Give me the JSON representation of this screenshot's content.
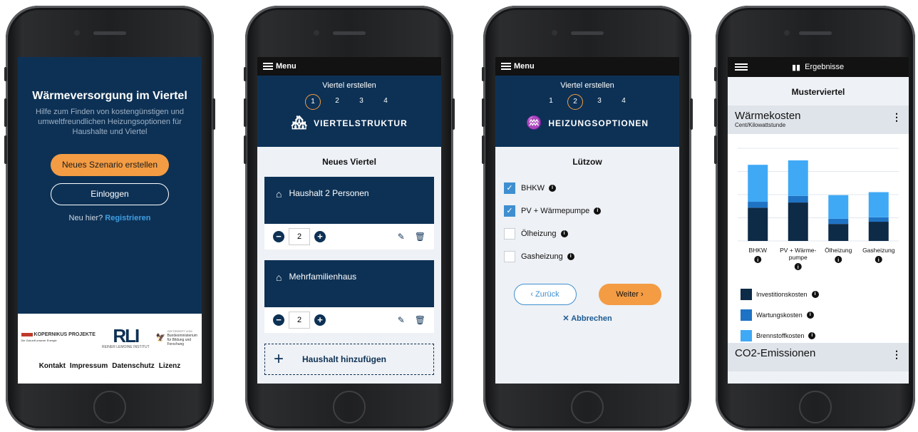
{
  "screen1": {
    "title": "Wärmeversorgung im Viertel",
    "subtitle": "Hilfe zum Finden von kostengünstigen und umweltfreundlichen Heizungsoptionen für Haushalte und Viertel",
    "primary_button": "Neues Szenario erstellen",
    "login_button": "Einloggen",
    "new_here": "Neu hier?",
    "register_link": "Registrieren",
    "logo_kopernikus": "KOPERNIKUS PROJEKTE",
    "logo_kopernikus_sub": "Die Zukunft unserer Energie",
    "logo_rli": "RLI",
    "logo_rli_sub": "REINER LEMOINE INSTITUT",
    "logo_bmbf_top": "GEFÖRDERT VOM",
    "logo_bmbf": "Bundesministerium für Bildung und Forschung",
    "footer_links": [
      "Kontakt",
      "Impressum",
      "Datenschutz",
      "Lizenz"
    ]
  },
  "screen2": {
    "menu": "Menu",
    "wizard_title": "Viertel erstellen",
    "steps": [
      "1",
      "2",
      "3",
      "4"
    ],
    "active_step": "1",
    "section": "VIERTELSTRUKTUR",
    "heading": "Neues Viertel",
    "cards": [
      {
        "label": "Haushalt 2 Personen",
        "count": "2"
      },
      {
        "label": "Mehrfamilienhaus",
        "count": "2"
      }
    ],
    "add_button": "Haushalt hinzufügen"
  },
  "screen3": {
    "menu": "Menu",
    "wizard_title": "Viertel erstellen",
    "steps": [
      "1",
      "2",
      "3",
      "4"
    ],
    "active_step": "2",
    "section": "HEIZUNGSOPTIONEN",
    "heading": "Lützow",
    "options": [
      {
        "label": "BHKW",
        "checked": true
      },
      {
        "label": "PV + Wärmepumpe",
        "checked": true
      },
      {
        "label": "Ölheizung",
        "checked": false
      },
      {
        "label": "Gasheizung",
        "checked": false
      }
    ],
    "back_button": "Zurück",
    "next_button": "Weiter",
    "cancel_link": "Abbrechen"
  },
  "screen4": {
    "top_title": "Ergebnisse",
    "heading": "Musterviertel",
    "section1_title": "Wärmekosten",
    "section1_unit": "Cent/Kilowattstunde",
    "section2_title": "CO2-Emissionen",
    "legend": [
      "Investitionskosten",
      "Wartungskosten",
      "Brennstoffkosten"
    ]
  },
  "colors": {
    "navy": "#0d3155",
    "orange": "#f39c44",
    "blue_mid": "#1f73c4",
    "blue_light": "#3fa9f5",
    "navy_dark": "#0d2a47"
  },
  "chart_data": {
    "type": "bar",
    "stacked": true,
    "categories": [
      "BHKW",
      "PV + Wärme-pumpe",
      "Ölheizung",
      "Gasheizung"
    ],
    "series": [
      {
        "name": "Investitionskosten",
        "values": [
          4.5,
          5.2,
          2.3,
          2.6
        ]
      },
      {
        "name": "Wartungskosten",
        "values": [
          0.8,
          0.9,
          0.7,
          0.6
        ]
      },
      {
        "name": "Brennstoffkosten",
        "values": [
          5.0,
          4.8,
          3.2,
          3.4
        ]
      }
    ],
    "grid": true,
    "legend_position": "bottom-left"
  }
}
